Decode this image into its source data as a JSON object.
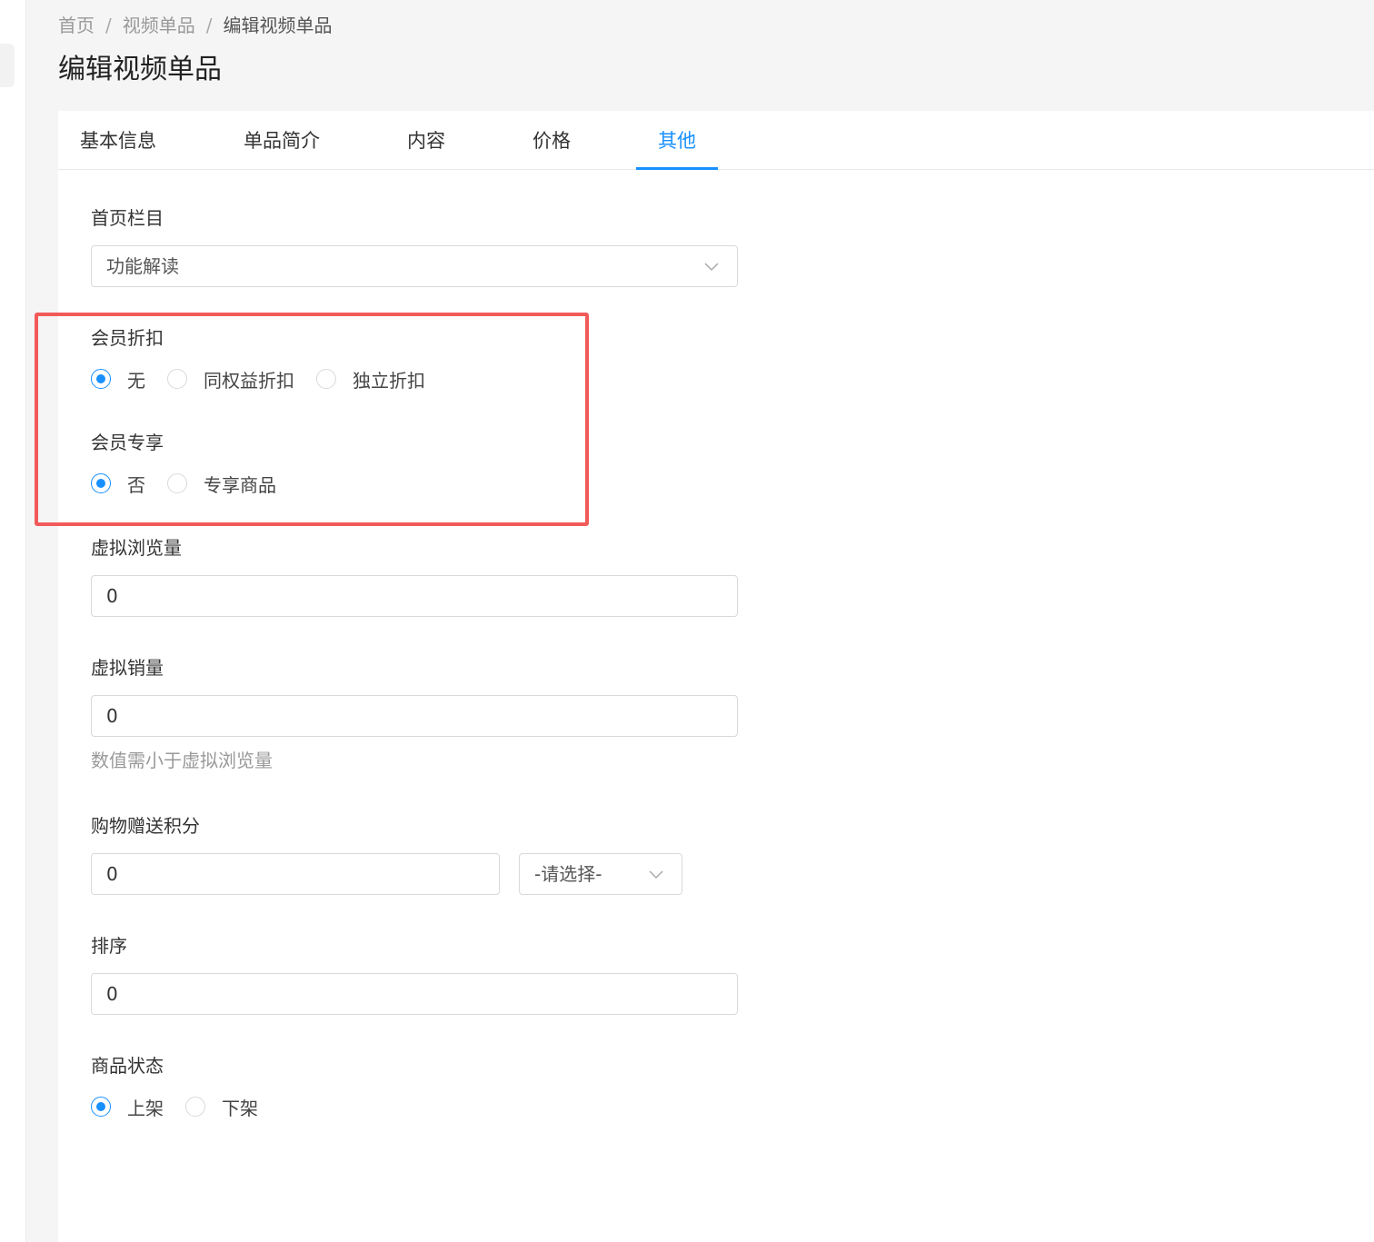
{
  "breadcrumb": {
    "items": [
      "首页",
      "视频单品",
      "编辑视频单品"
    ],
    "separator": "/"
  },
  "page_title": "编辑视频单品",
  "tabs": [
    {
      "label": "基本信息",
      "active": false
    },
    {
      "label": "单品简介",
      "active": false
    },
    {
      "label": "内容",
      "active": false
    },
    {
      "label": "价格",
      "active": false
    },
    {
      "label": "其他",
      "active": true
    }
  ],
  "form": {
    "home_column": {
      "label": "首页栏目",
      "value": "功能解读"
    },
    "member_discount": {
      "label": "会员折扣",
      "options": [
        "无",
        "同权益折扣",
        "独立折扣"
      ],
      "selected": "无"
    },
    "member_exclusive": {
      "label": "会员专享",
      "options": [
        "否",
        "专享商品"
      ],
      "selected": "否"
    },
    "virtual_views": {
      "label": "虚拟浏览量",
      "value": "0"
    },
    "virtual_sales": {
      "label": "虚拟销量",
      "value": "0",
      "hint": "数值需小于虚拟浏览量"
    },
    "bonus_points": {
      "label": "购物赠送积分",
      "value": "0",
      "unit_placeholder": "-请选择-"
    },
    "sort": {
      "label": "排序",
      "value": "0"
    },
    "status": {
      "label": "商品状态",
      "options": [
        "上架",
        "下架"
      ],
      "selected": "上架"
    }
  },
  "colors": {
    "accent": "#1890ff",
    "highlight": "#f25a5a",
    "border": "#d9d9d9",
    "background": "#f5f5f5"
  }
}
